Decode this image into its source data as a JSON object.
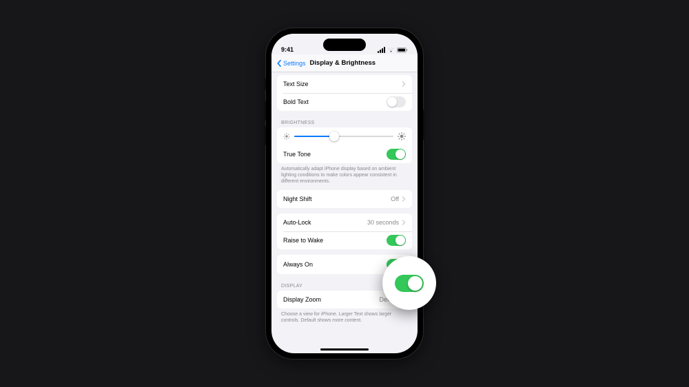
{
  "status": {
    "time": "9:41"
  },
  "nav": {
    "back_label": "Settings",
    "title": "Display & Brightness"
  },
  "text_size": {
    "label": "Text Size"
  },
  "bold_text": {
    "label": "Bold Text",
    "on": false
  },
  "brightness": {
    "header": "BRIGHTNESS",
    "value_pct": 40,
    "true_tone": {
      "label": "True Tone",
      "on": true
    },
    "footer": "Automatically adapt iPhone display based on ambient lighting conditions to make colors appear consistent in different environments."
  },
  "night_shift": {
    "label": "Night Shift",
    "value": "Off"
  },
  "auto_lock": {
    "label": "Auto-Lock",
    "value": "30 seconds"
  },
  "raise_to_wake": {
    "label": "Raise to Wake",
    "on": true
  },
  "always_on": {
    "label": "Always On",
    "on": true
  },
  "display": {
    "header": "DISPLAY",
    "zoom": {
      "label": "Display Zoom",
      "value": "Default"
    },
    "footer": "Choose a view for iPhone. Larger Text shows larger controls. Default shows more content."
  }
}
